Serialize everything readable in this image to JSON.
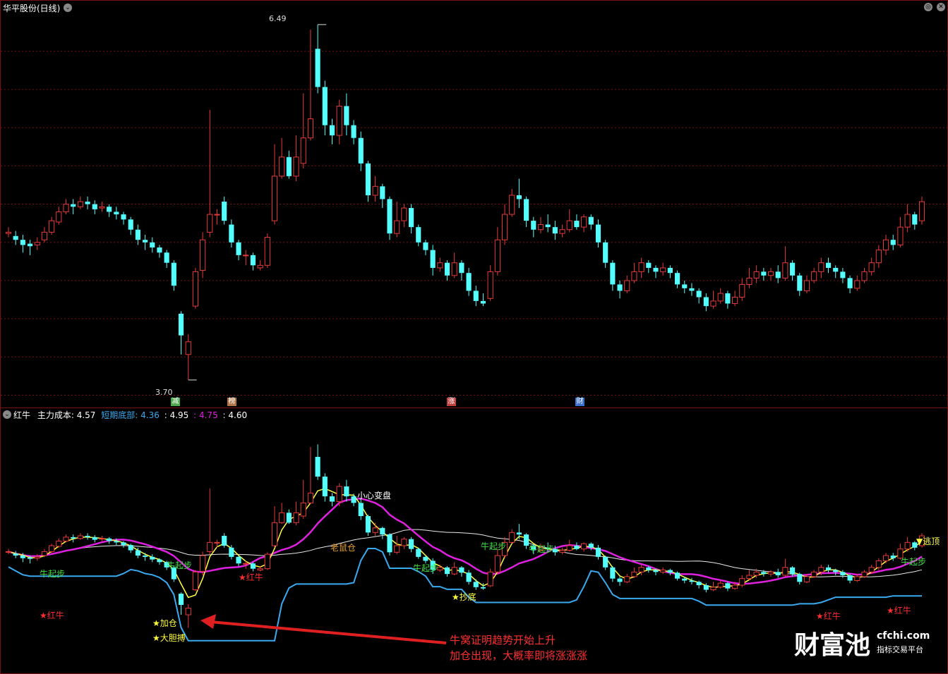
{
  "window": {
    "title": "华平股份(日线)",
    "price_high_label": "6.49",
    "price_low_label": "3.70",
    "event_badges": [
      {
        "text": "减",
        "color": "#4fa84f"
      },
      {
        "text": "榜",
        "color": "#b0764a"
      },
      {
        "text": "涨",
        "color": "#c04040"
      },
      {
        "text": "财",
        "color": "#3a6fd0"
      }
    ]
  },
  "indicator": {
    "name": "红牛",
    "main_cost_label": "主力成本:",
    "main_cost_value": "4.57",
    "short_bottom_label": "短期底部:",
    "short_bottom_value": "4.36",
    "v2": "4.95",
    "v3": "4.75",
    "v4": "4.60",
    "colon": ":"
  },
  "annotations": {
    "hongniu": "★红牛",
    "niu_qibu": "牛起步",
    "jiacang": "★加仓",
    "dadan_bo": "★大胆搏",
    "chaodi": "★抄底",
    "laoshu_cang": "老鼠仓",
    "xiaoxin_biandpan": "小心变盘",
    "taoding": "▼逃顶",
    "callout_line1": "牛窝证明趋势开始上升",
    "callout_line2": "加仓出现，大概率即将涨涨涨"
  },
  "logo": {
    "main": "财富池",
    "domain": "cfchi.com",
    "tagline": "指标交易平台"
  },
  "colors": {
    "up": "#e83a3a",
    "down": "#54ffff",
    "ma_magenta": "#e020e0",
    "ma_white": "#e8e8e8",
    "ma_yellow": "#ffff40",
    "bottom_line": "#3aaaf0",
    "grid": "#7a1010"
  },
  "chart_data": {
    "type": "candlestick",
    "price_range": [
      3.6,
      6.6
    ],
    "candles": [
      [
        4.85,
        4.86,
        4.9,
        4.82
      ],
      [
        4.83,
        4.8,
        4.87,
        4.76
      ],
      [
        4.8,
        4.76,
        4.84,
        4.7
      ],
      [
        4.77,
        4.75,
        4.8,
        4.68
      ],
      [
        4.76,
        4.78,
        4.82,
        4.72
      ],
      [
        4.8,
        4.86,
        4.9,
        4.78
      ],
      [
        4.86,
        4.95,
        4.98,
        4.84
      ],
      [
        4.94,
        5.02,
        5.06,
        4.92
      ],
      [
        5.02,
        5.08,
        5.12,
        5.0
      ],
      [
        5.08,
        5.06,
        5.12,
        5.0
      ],
      [
        5.06,
        5.1,
        5.14,
        5.04
      ],
      [
        5.1,
        5.08,
        5.14,
        5.04
      ],
      [
        5.08,
        5.04,
        5.11,
        5.0
      ],
      [
        5.05,
        5.06,
        5.1,
        5.02
      ],
      [
        5.06,
        5.02,
        5.08,
        4.98
      ],
      [
        5.02,
        5.0,
        5.06,
        4.96
      ],
      [
        5.0,
        4.96,
        5.02,
        4.92
      ],
      [
        4.96,
        4.88,
        4.98,
        4.84
      ],
      [
        4.88,
        4.8,
        4.92,
        4.76
      ],
      [
        4.8,
        4.78,
        4.84,
        4.72
      ],
      [
        4.78,
        4.74,
        4.82,
        4.7
      ],
      [
        4.74,
        4.7,
        4.76,
        4.66
      ],
      [
        4.7,
        4.62,
        4.72,
        4.58
      ],
      [
        4.62,
        4.44,
        4.64,
        4.4
      ],
      [
        4.22,
        4.05,
        4.24,
        3.9
      ],
      [
        3.9,
        4.0,
        4.06,
        3.7
      ],
      [
        4.28,
        4.55,
        4.58,
        4.26
      ],
      [
        4.56,
        4.8,
        4.86,
        4.5
      ],
      [
        4.86,
        5.0,
        5.82,
        4.82
      ],
      [
        5.0,
        5.0,
        5.04,
        4.92
      ],
      [
        5.1,
        4.95,
        5.14,
        4.92
      ],
      [
        4.92,
        4.78,
        4.96,
        4.74
      ],
      [
        4.78,
        4.68,
        4.8,
        4.64
      ],
      [
        4.68,
        4.68,
        4.72,
        4.6
      ],
      [
        4.68,
        4.6,
        4.7,
        4.56
      ],
      [
        4.58,
        4.6,
        4.64,
        4.56
      ],
      [
        4.6,
        4.82,
        4.85,
        4.58
      ],
      [
        4.95,
        5.3,
        5.55,
        4.92
      ],
      [
        5.3,
        5.45,
        5.6,
        5.28
      ],
      [
        5.45,
        5.3,
        5.5,
        5.28
      ],
      [
        5.3,
        5.45,
        5.62,
        5.26
      ],
      [
        5.4,
        5.6,
        5.95,
        5.36
      ],
      [
        5.6,
        5.75,
        6.45,
        5.58
      ],
      [
        6.3,
        6.0,
        6.49,
        5.95
      ],
      [
        6.0,
        5.7,
        6.05,
        5.62
      ],
      [
        5.7,
        5.62,
        5.75,
        5.55
      ],
      [
        5.62,
        5.85,
        5.9,
        5.55
      ],
      [
        5.85,
        5.7,
        5.95,
        5.62
      ],
      [
        5.7,
        5.6,
        5.74,
        5.55
      ],
      [
        5.6,
        5.4,
        5.65,
        5.34
      ],
      [
        5.4,
        5.15,
        5.42,
        5.1
      ],
      [
        5.15,
        5.22,
        5.3,
        5.1
      ],
      [
        5.22,
        5.12,
        5.24,
        5.05
      ],
      [
        5.12,
        4.85,
        5.14,
        4.8
      ],
      [
        4.85,
        4.95,
        5.1,
        4.82
      ],
      [
        4.95,
        5.05,
        5.08,
        4.9
      ],
      [
        5.05,
        4.9,
        5.08,
        4.85
      ],
      [
        4.9,
        4.78,
        4.92,
        4.75
      ],
      [
        4.78,
        4.72,
        4.8,
        4.68
      ],
      [
        4.72,
        4.58,
        4.76,
        4.52
      ],
      [
        4.58,
        4.62,
        4.66,
        4.55
      ],
      [
        4.62,
        4.52,
        4.64,
        4.48
      ],
      [
        4.52,
        4.62,
        4.7,
        4.5
      ],
      [
        4.62,
        4.54,
        4.64,
        4.48
      ],
      [
        4.54,
        4.4,
        4.58,
        4.36
      ],
      [
        4.4,
        4.32,
        4.44,
        4.28
      ],
      [
        4.32,
        4.3,
        4.38,
        4.28
      ],
      [
        4.34,
        4.55,
        4.6,
        4.32
      ],
      [
        4.55,
        4.8,
        4.9,
        4.52
      ],
      [
        4.8,
        5.0,
        5.08,
        4.76
      ],
      [
        5.0,
        5.15,
        5.2,
        4.98
      ],
      [
        5.15,
        5.12,
        5.28,
        5.05
      ],
      [
        5.12,
        4.95,
        5.14,
        4.9
      ],
      [
        4.95,
        4.88,
        4.98,
        4.82
      ],
      [
        4.88,
        4.92,
        4.98,
        4.85
      ],
      [
        4.92,
        4.9,
        5.0,
        4.86
      ],
      [
        4.9,
        4.85,
        4.95,
        4.8
      ],
      [
        4.85,
        4.88,
        4.92,
        4.82
      ],
      [
        4.88,
        4.95,
        5.04,
        4.86
      ],
      [
        4.95,
        4.9,
        5.0,
        4.88
      ],
      [
        4.9,
        4.98,
        5.0,
        4.86
      ],
      [
        4.98,
        4.92,
        5.0,
        4.88
      ],
      [
        4.92,
        4.78,
        4.96,
        4.74
      ],
      [
        4.78,
        4.62,
        4.8,
        4.58
      ],
      [
        4.62,
        4.45,
        4.64,
        4.4
      ],
      [
        4.45,
        4.4,
        4.48,
        4.34
      ],
      [
        4.4,
        4.48,
        4.52,
        4.38
      ],
      [
        4.48,
        4.55,
        4.62,
        4.46
      ],
      [
        4.55,
        4.62,
        4.66,
        4.5
      ],
      [
        4.62,
        4.58,
        4.64,
        4.54
      ],
      [
        4.58,
        4.55,
        4.6,
        4.5
      ],
      [
        4.55,
        4.58,
        4.62,
        4.52
      ],
      [
        4.58,
        4.54,
        4.6,
        4.5
      ],
      [
        4.54,
        4.45,
        4.56,
        4.42
      ],
      [
        4.45,
        4.42,
        4.48,
        4.38
      ],
      [
        4.42,
        4.4,
        4.46,
        4.36
      ],
      [
        4.4,
        4.35,
        4.42,
        4.3
      ],
      [
        4.35,
        4.28,
        4.38,
        4.24
      ],
      [
        4.28,
        4.32,
        4.4,
        4.26
      ],
      [
        4.32,
        4.38,
        4.42,
        4.3
      ],
      [
        4.38,
        4.3,
        4.4,
        4.26
      ],
      [
        4.3,
        4.35,
        4.4,
        4.28
      ],
      [
        4.35,
        4.45,
        4.5,
        4.32
      ],
      [
        4.45,
        4.5,
        4.58,
        4.42
      ],
      [
        4.5,
        4.55,
        4.6,
        4.46
      ],
      [
        4.55,
        4.52,
        4.58,
        4.48
      ],
      [
        4.52,
        4.55,
        4.58,
        4.48
      ],
      [
        4.55,
        4.5,
        4.6,
        4.46
      ],
      [
        4.5,
        4.62,
        4.75,
        4.48
      ],
      [
        4.62,
        4.52,
        4.64,
        4.48
      ],
      [
        4.52,
        4.4,
        4.54,
        4.36
      ],
      [
        4.4,
        4.48,
        4.52,
        4.38
      ],
      [
        4.48,
        4.55,
        4.58,
        4.46
      ],
      [
        4.55,
        4.62,
        4.66,
        4.5
      ],
      [
        4.62,
        4.58,
        4.66,
        4.54
      ],
      [
        4.58,
        4.55,
        4.6,
        4.5
      ],
      [
        4.55,
        4.5,
        4.58,
        4.46
      ],
      [
        4.5,
        4.42,
        4.52,
        4.38
      ],
      [
        4.42,
        4.48,
        4.52,
        4.4
      ],
      [
        4.48,
        4.55,
        4.58,
        4.46
      ],
      [
        4.55,
        4.62,
        4.66,
        4.52
      ],
      [
        4.62,
        4.72,
        4.76,
        4.58
      ],
      [
        4.72,
        4.8,
        4.84,
        4.68
      ],
      [
        4.8,
        4.76,
        4.84,
        4.72
      ],
      [
        4.76,
        4.9,
        4.98,
        4.74
      ],
      [
        4.9,
        5.0,
        5.08,
        4.86
      ],
      [
        5.0,
        4.92,
        5.02,
        4.88
      ],
      [
        4.95,
        5.1,
        5.14,
        4.92
      ]
    ]
  }
}
